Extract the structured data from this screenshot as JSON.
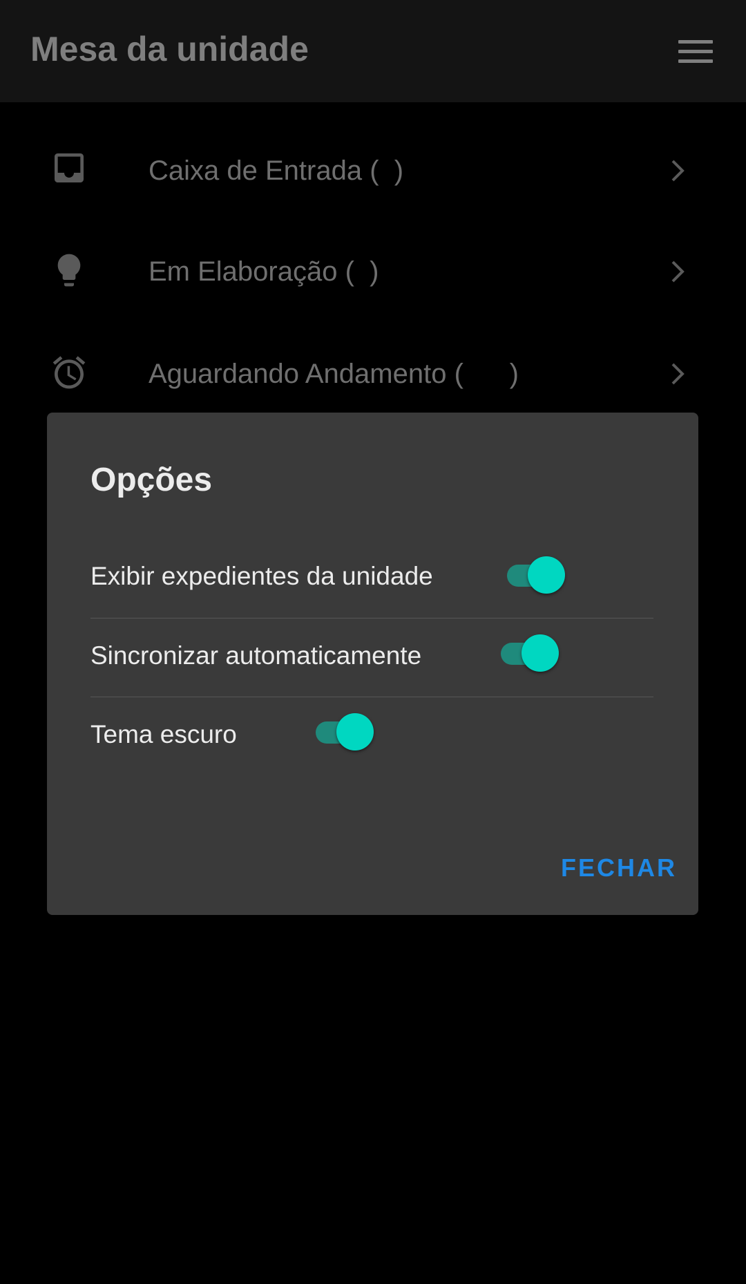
{
  "appbar": {
    "title": "Mesa da unidade",
    "menu_icon": "hamburger-menu-icon"
  },
  "list": {
    "items": [
      {
        "label": "Caixa de Entrada (  )",
        "icon": "inbox-icon"
      },
      {
        "label": "Em Elaboração (  )",
        "icon": "lightbulb-icon"
      },
      {
        "label": "Aguardando Andamento (      )",
        "icon": "alarm-clock-icon"
      }
    ]
  },
  "dialog": {
    "title": "Opções",
    "options": [
      {
        "label": "Exibir expedientes da unidade",
        "enabled": true
      },
      {
        "label": "Sincronizar automaticamente",
        "enabled": true
      },
      {
        "label": "Tema escuro",
        "enabled": true
      }
    ],
    "close_label": "FECHAR"
  },
  "colors": {
    "toggle_thumb": "#00d7c1",
    "toggle_track": "#1f8a7c",
    "button_accent": "#1e88e5",
    "dialog_background": "#3a3a3a"
  }
}
